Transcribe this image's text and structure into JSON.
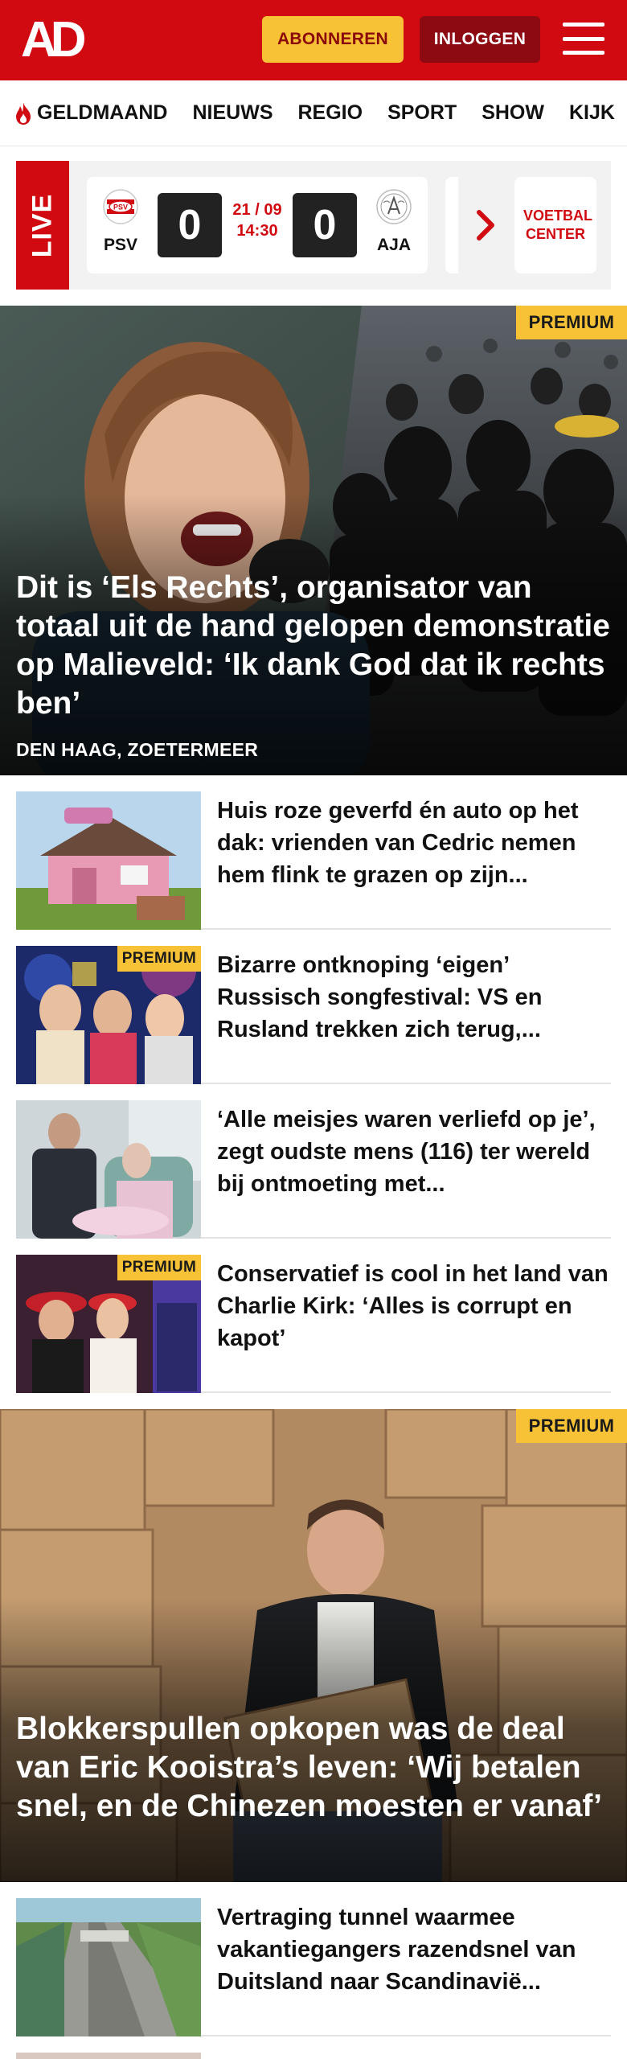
{
  "header": {
    "logo_text": "AD",
    "subscribe_label": "ABONNEREN",
    "login_label": "INLOGGEN",
    "brand_color": "#d10a11",
    "subscribe_color": "#f7c236"
  },
  "nav": {
    "items": [
      {
        "label": "GELDMAAND",
        "icon": "flame-icon"
      },
      {
        "label": "NIEUWS"
      },
      {
        "label": "REGIO"
      },
      {
        "label": "SPORT"
      },
      {
        "label": "SHOW"
      },
      {
        "label": "KIJK"
      }
    ]
  },
  "live": {
    "tag": "LIVE",
    "home_team": "PSV",
    "away_team": "AJA",
    "home_score": "0",
    "away_score": "0",
    "date": "21 / 09",
    "time": "14:30",
    "voetbal_center": "VOETBAL CENTER"
  },
  "articles": {
    "hero1": {
      "badge": "PREMIUM",
      "title": "Dit is ‘Els Rechts’, organisator van totaal uit de hand gelopen demonstra­tie op Malieveld: ‘Ik dank God dat ik rechts ben’",
      "location": "DEN HAAG, ZOETERMEER"
    },
    "list1": [
      {
        "title": "Huis roze geverfd én auto op het dak: vrienden van Cedric nemen hem flink te grazen op zijn...",
        "premium": ""
      },
      {
        "title": "Bizarre ontknoping ‘eigen’ Russisch songfestival: VS en Rusland trekken zich terug,...",
        "premium": "PREMIUM"
      },
      {
        "title": "‘Alle meisjes waren verliefd op je’, zegt oudste mens (116) ter wereld bij ontmoeting met...",
        "premium": ""
      },
      {
        "title": "Conservatief is cool in het land van Charlie Kirk: ‘Alles is corrupt en kapot’",
        "premium": "PREMIUM"
      }
    ],
    "hero2": {
      "badge": "PREMIUM",
      "title": "Blokkerspullen opkopen was de deal van Eric Kooistra’s leven: ‘Wij betalen snel, en de Chinezen moesten er vanaf’"
    },
    "list2": [
      {
        "title": "Vertraging tunnel waarmee vakantiegangers razendsnel van Duitsland naar Scandinavië...",
        "premium": ""
      }
    ]
  }
}
